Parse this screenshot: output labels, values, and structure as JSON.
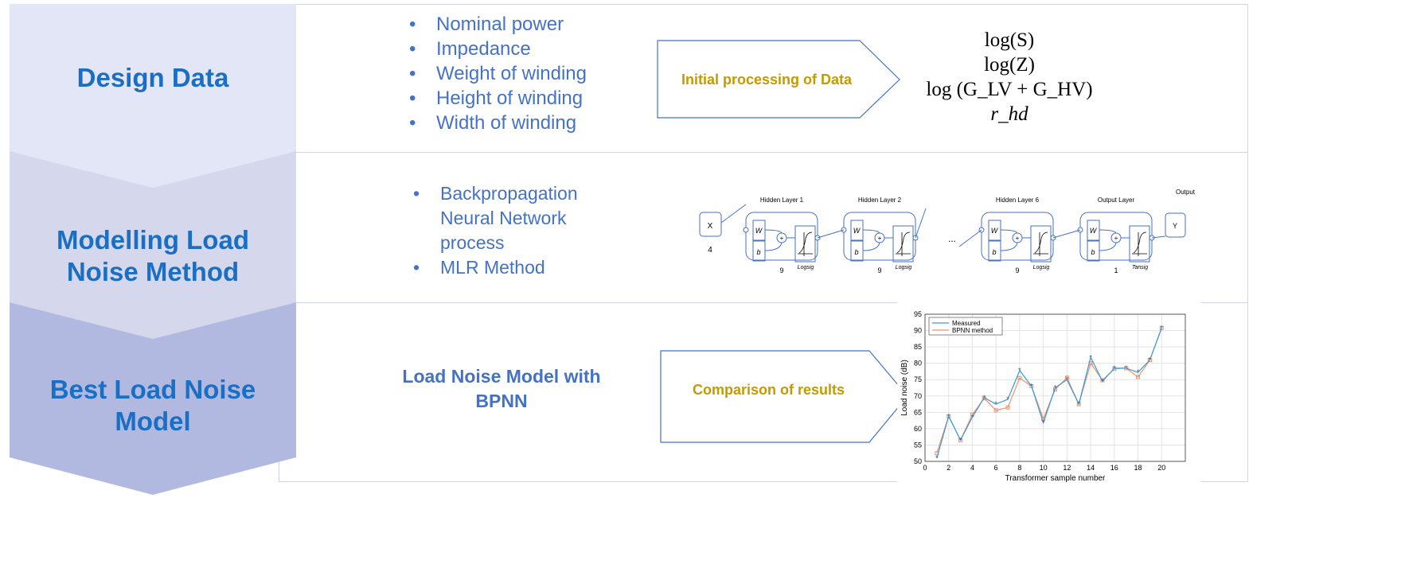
{
  "stages": [
    {
      "label": "Design Data",
      "color": "#e3e6f6"
    },
    {
      "label": "Modelling Load Noise Method",
      "color": "#d5d8ec"
    },
    {
      "label": "Best Load Noise Model",
      "color": "#b1b9e1"
    }
  ],
  "row1": {
    "bullets": [
      "Nominal power",
      "Impedance",
      "Weight of winding",
      "Height of winding",
      "Width of winding"
    ],
    "arrow_label": "Initial processing of Data",
    "formulas": [
      "log(S)",
      "log(Z)",
      "log (G_LV + G_HV)",
      "r_hd"
    ]
  },
  "row2": {
    "bullets": [
      "Backpropagation Neural Network process",
      "MLR Method"
    ],
    "network": {
      "input": "X",
      "input_size": "4",
      "layers": [
        {
          "title": "Hidden Layer 1",
          "activation": "Logsig",
          "size": "9"
        },
        {
          "title": "Hidden Layer 2",
          "activation": "Logsig",
          "size": "9"
        },
        {
          "title": "Hidden Layer 6",
          "activation": "Logsig",
          "size": "9"
        },
        {
          "title": "Output Layer",
          "activation": "Tansig",
          "size": "1"
        }
      ],
      "weight": "W",
      "bias": "b",
      "sum": "+",
      "ellipsis": "...",
      "output_title": "Output",
      "output": "Y"
    }
  },
  "row3": {
    "model_label": "Load Noise Model with BPNN",
    "arrow_label": "Comparison of results"
  },
  "colors": {
    "stage_text": "#1a6fc4",
    "bullet_text": "#4472c4",
    "arrow_text": "#c49a00",
    "measured": "#3a9ad9",
    "bpnn": "#f0906a"
  },
  "chart_data": {
    "type": "line",
    "xlabel": "Transformer sample number",
    "ylabel": "Load noise (dB)",
    "xlim": [
      0,
      22
    ],
    "ylim": [
      50,
      95
    ],
    "xticks": [
      0,
      2,
      4,
      6,
      8,
      10,
      12,
      14,
      16,
      18,
      20
    ],
    "yticks": [
      50,
      55,
      60,
      65,
      70,
      75,
      80,
      85,
      90,
      95
    ],
    "grid": true,
    "legend": "top-left",
    "x": [
      1,
      2,
      3,
      4,
      5,
      6,
      7,
      8,
      9,
      10,
      11,
      12,
      13,
      14,
      15,
      16,
      17,
      18,
      19,
      20
    ],
    "series": [
      {
        "name": "Measured",
        "marker": "star",
        "values": [
          51,
          63.8,
          56.5,
          63.5,
          69.5,
          67.5,
          69,
          77.8,
          73,
          61.8,
          72.5,
          75,
          67.5,
          81.8,
          74.5,
          78.5,
          78.5,
          77.2,
          81,
          90.8
        ]
      },
      {
        "name": "BPNN method",
        "marker": "square",
        "values": [
          52.5,
          63.8,
          56.5,
          64.3,
          69.3,
          65.6,
          66.5,
          75.5,
          73,
          63,
          72,
          75.6,
          67.5,
          80,
          74.8,
          78.3,
          78.5,
          75.8,
          81,
          90.8
        ]
      }
    ]
  }
}
